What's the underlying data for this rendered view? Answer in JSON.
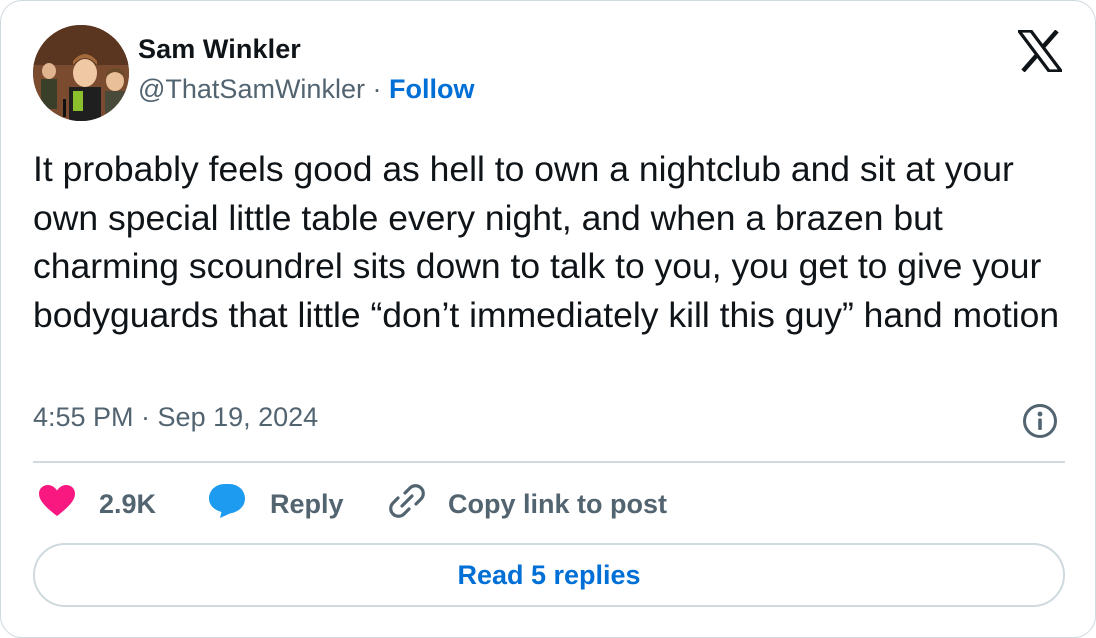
{
  "author": {
    "name": "Sam Winkler",
    "handle": "@ThatSamWinkler",
    "separator": "·",
    "follow_label": "Follow"
  },
  "tweet": {
    "text": "It probably feels good as hell to own a nightclub and sit at your own special little table every night, and when a brazen but charming scoundrel sits down to talk to you, you get to give your bodyguards that little “don’t immediately kill this guy” hand motion",
    "timestamp": "4:55 PM · Sep 19, 2024"
  },
  "actions": {
    "like_count": "2.9K",
    "reply_label": "Reply",
    "copy_link_label": "Copy link to post"
  },
  "read_replies_label": "Read 5 replies",
  "icons": {
    "platform_logo": "x-logo-icon",
    "info": "info-icon",
    "like": "heart-icon",
    "reply": "speech-bubble-icon",
    "copy": "link-icon"
  },
  "colors": {
    "text_primary": "#0f1419",
    "text_secondary": "#536471",
    "link_blue": "#006fd6",
    "heart_pink": "#f91880",
    "reply_blue": "#1d9bf0",
    "border": "#cfd9de"
  }
}
